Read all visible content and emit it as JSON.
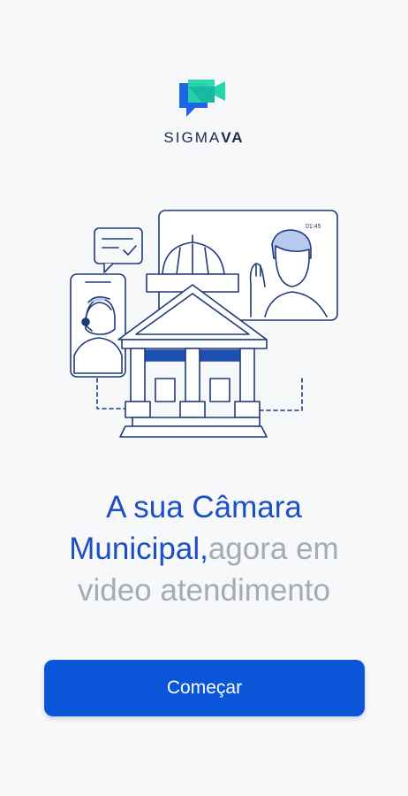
{
  "brand": {
    "name_prefix": "SIGMA",
    "name_suffix": "VA"
  },
  "hero": {
    "timer": "01:45",
    "headline_line1": "A sua Câmara",
    "headline_line2_blue": "Municipal,",
    "headline_line2_gray": "agora em",
    "headline_line3": "video atendimento"
  },
  "actions": {
    "start_label": "Começar"
  },
  "colors": {
    "accent": "#0a55d8",
    "headline_blue": "#1d4fc4",
    "muted": "#a5aab3",
    "logo_blue": "#1e66e6",
    "logo_green": "#22d8a8"
  }
}
